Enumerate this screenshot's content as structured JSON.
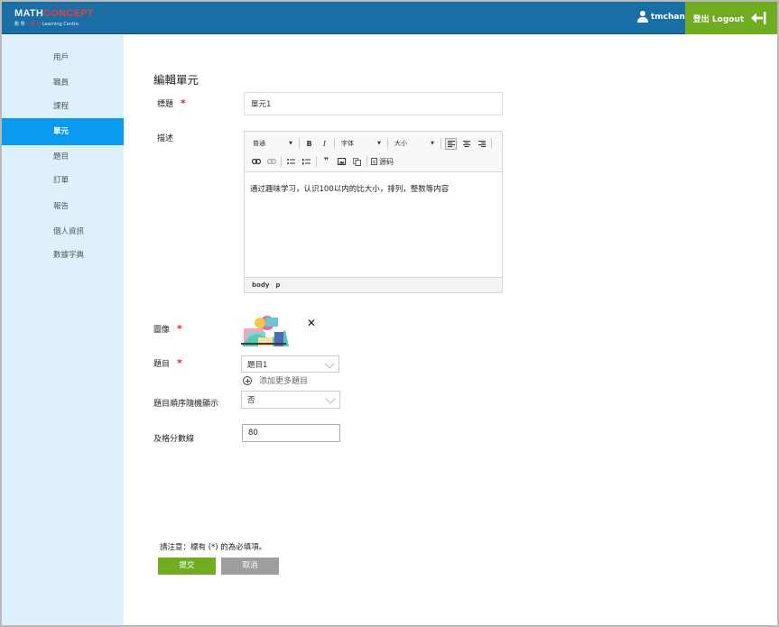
{
  "header": {
    "logo_math": "MATH",
    "logo_concept": "CONCEPT",
    "logo_sub_zh1": "數 學",
    "logo_sub_zh2": "概 念",
    "logo_sub_en": "Learning Centre",
    "username": "tmchan",
    "logout_label": "登出 Logout",
    "accent_color": "#1a6ea6",
    "logout_color": "#6fac1f"
  },
  "sidebar": {
    "items": [
      {
        "label": "用戶"
      },
      {
        "label": "職員"
      },
      {
        "label": "課程"
      },
      {
        "label": "單元",
        "active": true
      },
      {
        "label": "題目"
      },
      {
        "label": "訂單"
      },
      {
        "label": "報告"
      },
      {
        "label": "個人資訊"
      },
      {
        "label": "數據字典"
      }
    ],
    "active_color": "#0a9af0"
  },
  "form": {
    "page_title": "編輯單元",
    "title_label": "標題",
    "title_value": "單元1",
    "description_label": "描述",
    "editor": {
      "format_select": "普通",
      "font_select": "字体",
      "size_select": "大小",
      "source_label": "源码",
      "content": "通过趣味学习，认识100以内的比大小，排列，整数等内容",
      "status_path": [
        "body",
        "p"
      ],
      "icons": [
        "bold-icon",
        "italic-icon",
        "align-left-icon",
        "align-center-icon",
        "align-right-icon",
        "link-icon",
        "unlink-icon",
        "bulleted-list-icon",
        "numbered-list-icon",
        "blockquote-icon",
        "image-icon",
        "paste-icon",
        "source-icon"
      ]
    },
    "image_label": "圖像",
    "question_label": "題目",
    "question_value": "題目1",
    "add_more_label": "添加更多題目",
    "random_order_label": "題目順序隨機顯示",
    "random_order_value": "否",
    "pass_score_label": "及格分數線",
    "pass_score_value": "80",
    "required_mark": "*",
    "note": "請注意：標有 (*) 的為必填項。",
    "submit_label": "提交",
    "cancel_label": "取消"
  }
}
